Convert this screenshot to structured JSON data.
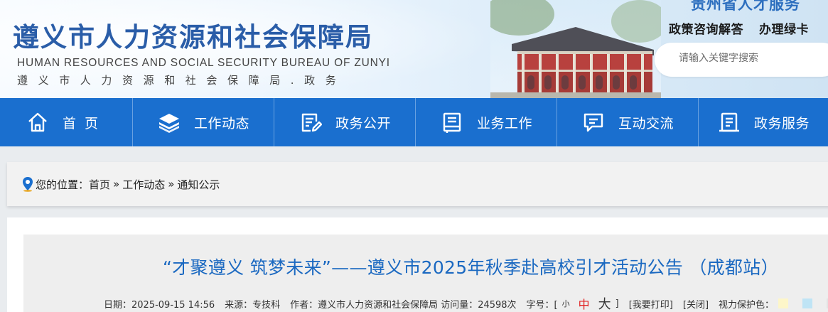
{
  "header": {
    "title": "遵义市人力资源和社会保障局",
    "subtitle_en": "HUMAN RESOURCES AND SOCIAL SECURITY BUREAU OF ZUNYI",
    "subtitle_cn": "遵义市人力资源和社会保障局.政务",
    "province_banner": "贵州省人才服务",
    "quick_links": [
      "政策咨询解答",
      "办理绿卡"
    ],
    "search_placeholder": "请输入关键字搜索"
  },
  "nav": {
    "items": [
      {
        "label": "首页",
        "icon": "home-icon"
      },
      {
        "label": "工作动态",
        "icon": "layers-icon"
      },
      {
        "label": "政务公开",
        "icon": "document-edit-icon"
      },
      {
        "label": "业务工作",
        "icon": "book-icon"
      },
      {
        "label": "互动交流",
        "icon": "chat-icon"
      },
      {
        "label": "政务服务",
        "icon": "list-document-icon"
      }
    ]
  },
  "breadcrumb": {
    "prefix": "您的位置：",
    "items": [
      "首页",
      "工作动态",
      "通知公示"
    ],
    "separator": "»"
  },
  "article": {
    "title": "“才聚遵义 筑梦未来”——遵义市2025年秋季赴高校引才活动公告 （成都站）",
    "date_label": "日期：2025-09-15 14:56",
    "source_label": "来源：专技科",
    "author_label": "作者：遵义市人力资源和社会保障局",
    "views_label": "访问量：24598次",
    "font_size_label": "字号：[",
    "font_size_small": "小",
    "font_size_medium": "中",
    "font_size_large": "大",
    "font_size_close": "]",
    "print_label": "[我要打印]",
    "close_label": "[关闭]",
    "eye_care_label": "视力保护色："
  },
  "colors": {
    "brand_blue": "#1a6fcf",
    "title_blue": "#2a5da8",
    "article_title_blue": "#1b69c1",
    "active_font_red": "#e02020",
    "swatches": [
      "#fdf6c9",
      "#bfe4f5",
      "#e3e3e3"
    ]
  }
}
